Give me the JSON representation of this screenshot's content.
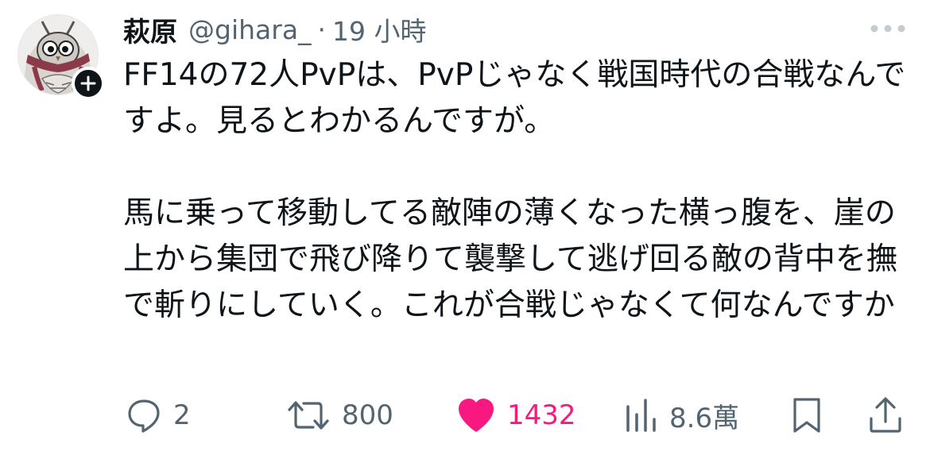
{
  "author": {
    "display_name": "萩原",
    "handle": "@gihara_",
    "separator": "·",
    "timestamp": "19 小時",
    "avatar_icon": "owl-avatar-icon",
    "follow_icon": "plus-icon"
  },
  "tweet": {
    "paragraph_1": "FF14の72人PvPは、PvPじゃなく戦国時代の合戦なんですよ。見るとわかるんですが。",
    "paragraph_2": "馬に乗って移動してる敵陣の薄くなった横っ腹を、崖の上から集団で飛び降りて襲撃して逃げ回る敵の背中を撫で斬りにしていく。これが合戦じゃなくて何なんですか"
  },
  "actions": {
    "reply": {
      "icon": "reply-icon",
      "count": "2"
    },
    "retweet": {
      "icon": "retweet-icon",
      "count": "800"
    },
    "like": {
      "icon": "heart-icon",
      "count": "1432",
      "liked": true
    },
    "views": {
      "icon": "views-chart-icon",
      "count": "8.6萬"
    },
    "bookmark": {
      "icon": "bookmark-icon"
    },
    "share": {
      "icon": "share-icon"
    }
  },
  "colors": {
    "text_primary": "#0f1419",
    "text_secondary": "#536471",
    "like_pink": "#f91880",
    "background": "#ffffff"
  },
  "more_icon": "more-dots-icon"
}
